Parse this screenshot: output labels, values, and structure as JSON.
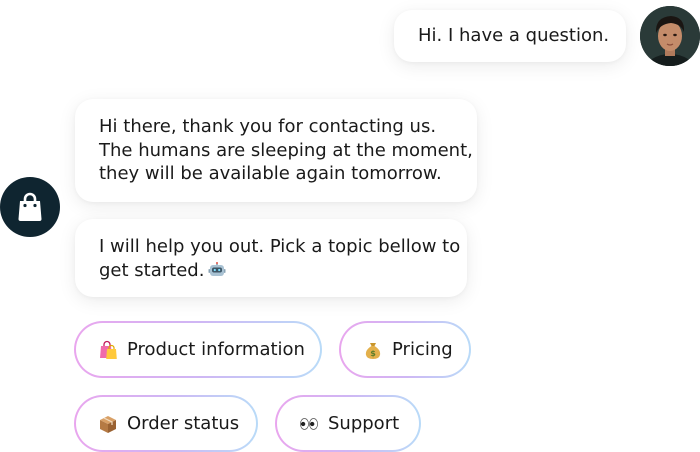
{
  "user_message": {
    "text": "Hi. I have a question."
  },
  "bot_messages": [
    {
      "lines": [
        "Hi there, thank you for contacting us.",
        "The humans are sleeping at the moment,",
        "they will be available again tomorrow."
      ]
    },
    {
      "lines": [
        "I will help you out. Pick a topic bellow to",
        "get started."
      ],
      "emoji": "robot-emoji"
    }
  ],
  "quick_replies": [
    {
      "label": "Product information",
      "icon": "shopping-bags-emoji"
    },
    {
      "label": "Pricing",
      "icon": "money-bag-emoji"
    },
    {
      "label": "Order status",
      "icon": "package-emoji"
    },
    {
      "label": "Support",
      "icon": "eyes-emoji"
    }
  ],
  "colors": {
    "chip_gradient": [
      "#e9a6ee",
      "#cfb6f4",
      "#b9dbf8"
    ],
    "bot_avatar_bg": "#0f2530",
    "text": "#1a1a1a"
  },
  "icons": {
    "user_avatar": "user-avatar-photo",
    "bot_avatar": "shopping-bag-icon"
  }
}
